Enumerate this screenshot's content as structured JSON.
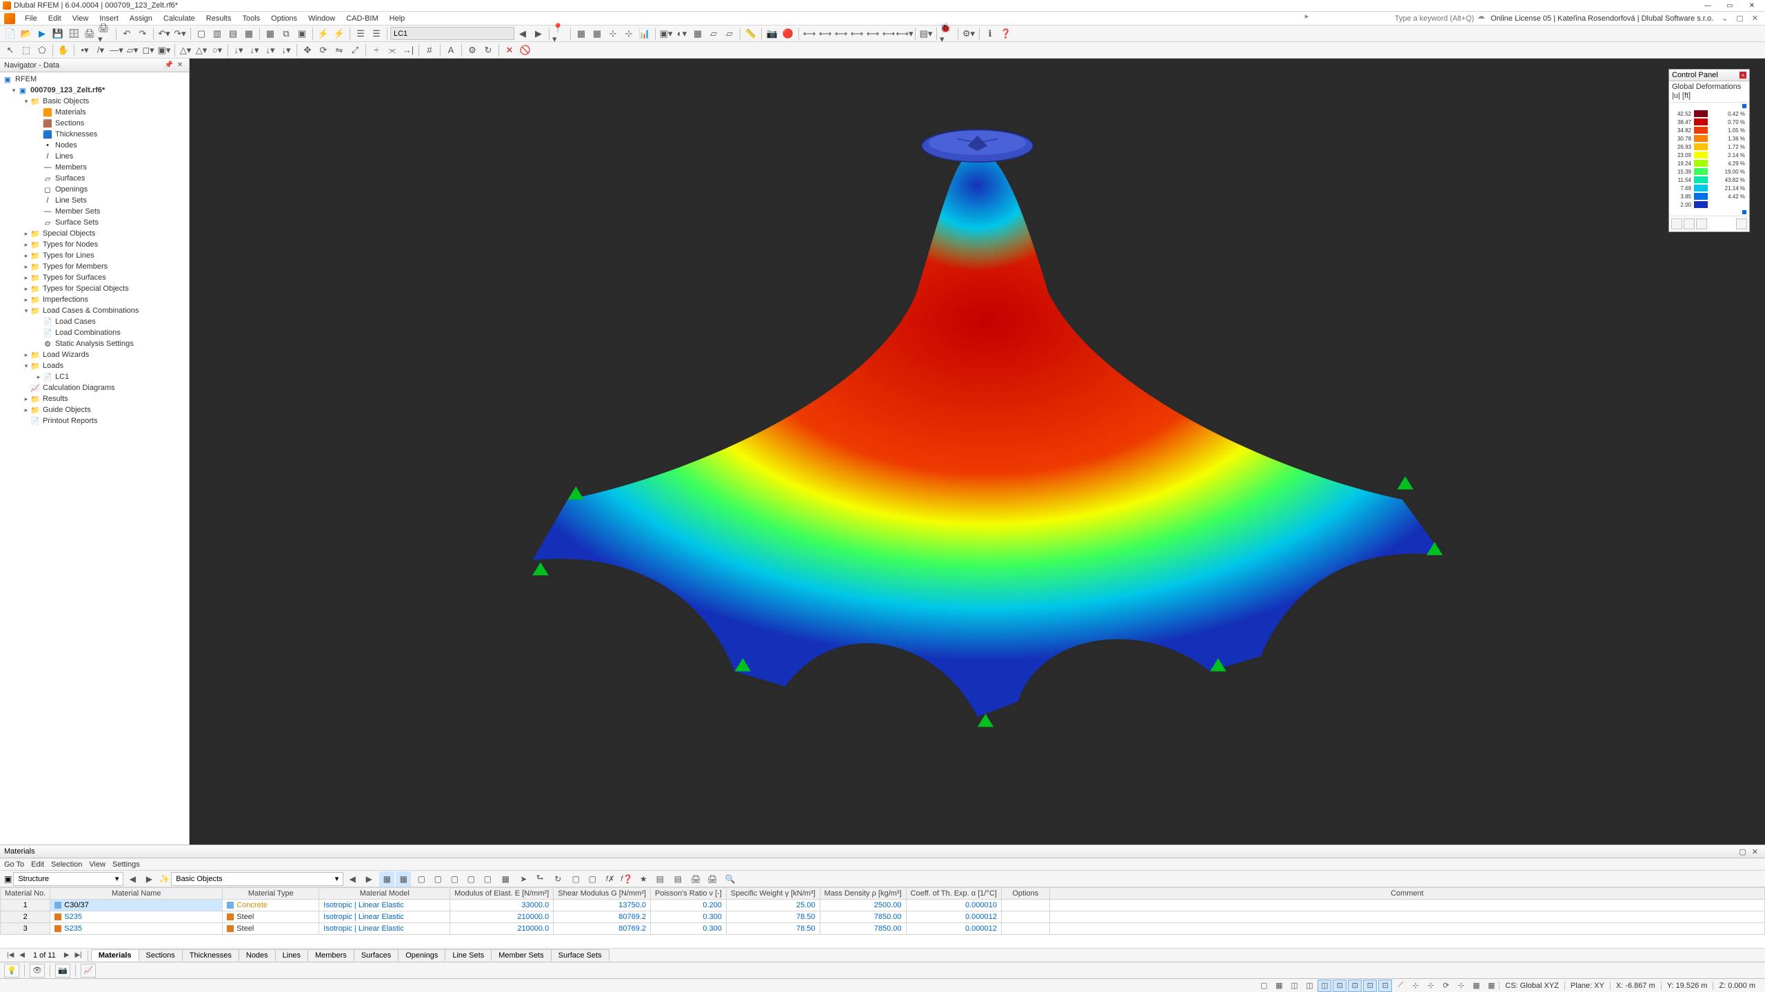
{
  "window": {
    "title": "Dlubal RFEM | 6.04.0004 | 000709_123_Zelt.rf6*",
    "search_placeholder": "Type a keyword (Alt+Q)",
    "license": "Online License 05 | Kateřina Rosendorfová | Dlubal Software s.r.o."
  },
  "menus": [
    "File",
    "Edit",
    "View",
    "Insert",
    "Assign",
    "Calculate",
    "Results",
    "Tools",
    "Options",
    "Window",
    "CAD-BIM",
    "Help"
  ],
  "toolbar": {
    "load_case": "LC1"
  },
  "navigator": {
    "title": "Navigator - Data",
    "root": "RFEM",
    "model": "000709_123_Zelt.rf6*",
    "items": [
      {
        "d": 1,
        "exp": true,
        "label": "Basic Objects",
        "folder": true
      },
      {
        "d": 2,
        "label": "Materials",
        "ic": "🟧"
      },
      {
        "d": 2,
        "label": "Sections",
        "ic": "🟫"
      },
      {
        "d": 2,
        "label": "Thicknesses",
        "ic": "🟦"
      },
      {
        "d": 2,
        "label": "Nodes",
        "ic": "•"
      },
      {
        "d": 2,
        "label": "Lines",
        "ic": "/"
      },
      {
        "d": 2,
        "label": "Members",
        "ic": "—"
      },
      {
        "d": 2,
        "label": "Surfaces",
        "ic": "▱"
      },
      {
        "d": 2,
        "label": "Openings",
        "ic": "◻"
      },
      {
        "d": 2,
        "label": "Line Sets",
        "ic": "/"
      },
      {
        "d": 2,
        "label": "Member Sets",
        "ic": "—"
      },
      {
        "d": 2,
        "label": "Surface Sets",
        "ic": "▱"
      },
      {
        "d": 1,
        "exp": false,
        "label": "Special Objects",
        "folder": true
      },
      {
        "d": 1,
        "exp": false,
        "label": "Types for Nodes",
        "folder": true
      },
      {
        "d": 1,
        "exp": false,
        "label": "Types for Lines",
        "folder": true
      },
      {
        "d": 1,
        "exp": false,
        "label": "Types for Members",
        "folder": true
      },
      {
        "d": 1,
        "exp": false,
        "label": "Types for Surfaces",
        "folder": true
      },
      {
        "d": 1,
        "exp": false,
        "label": "Types for Special Objects",
        "folder": true
      },
      {
        "d": 1,
        "exp": false,
        "label": "Imperfections",
        "folder": true
      },
      {
        "d": 1,
        "exp": true,
        "label": "Load Cases & Combinations",
        "folder": true
      },
      {
        "d": 2,
        "label": "Load Cases",
        "ic": "📄"
      },
      {
        "d": 2,
        "label": "Load Combinations",
        "ic": "📄"
      },
      {
        "d": 2,
        "label": "Static Analysis Settings",
        "ic": "⚙"
      },
      {
        "d": 1,
        "exp": false,
        "label": "Load Wizards",
        "folder": true
      },
      {
        "d": 1,
        "exp": true,
        "label": "Loads",
        "folder": true
      },
      {
        "d": 2,
        "label": "LC1",
        "ic": "📄",
        "exp": false
      },
      {
        "d": 1,
        "label": "Calculation Diagrams",
        "ic": "📈"
      },
      {
        "d": 1,
        "exp": false,
        "label": "Results",
        "folder": true
      },
      {
        "d": 1,
        "exp": false,
        "label": "Guide Objects",
        "folder": true
      },
      {
        "d": 1,
        "label": "Printout Reports",
        "ic": "📄"
      }
    ]
  },
  "control_panel": {
    "title": "Control Panel",
    "subtitle": "Global Deformations",
    "unit": "|u| [ft]",
    "legend": [
      {
        "val": "42.52",
        "color": "#7d0018",
        "pct": "0.42 %"
      },
      {
        "val": "38.47",
        "color": "#c40000",
        "pct": "0.70 %"
      },
      {
        "val": "34.82",
        "color": "#ee3b00",
        "pct": "1.05 %"
      },
      {
        "val": "30.78",
        "color": "#ff8200",
        "pct": "1.36 %"
      },
      {
        "val": "26.93",
        "color": "#ffc200",
        "pct": "1.72 %"
      },
      {
        "val": "23.09",
        "color": "#f5ff00",
        "pct": "2.14 %"
      },
      {
        "val": "19.24",
        "color": "#a6ff00",
        "pct": "4.29 %"
      },
      {
        "val": "15.39",
        "color": "#3dff5c",
        "pct": "19.00 %"
      },
      {
        "val": "11.54",
        "color": "#00e9a8",
        "pct": "43.82 %"
      },
      {
        "val": "7.69",
        "color": "#00c6e9",
        "pct": "21.14 %"
      },
      {
        "val": "3.85",
        "color": "#0070e9",
        "pct": "4.42 %"
      },
      {
        "val": "2.00",
        "color": "#1430b8",
        "pct": ""
      }
    ]
  },
  "materials": {
    "title": "Materials",
    "sub_menu": [
      "Go To",
      "Edit",
      "Selection",
      "View",
      "Settings"
    ],
    "structure_sel": "Structure",
    "basic_sel": "Basic Objects",
    "headers": {
      "no": "Material\nNo.",
      "name": "Material Name",
      "type": "Material\nType",
      "model": "Material Model",
      "E": "Modulus of Elast.\nE [N/mm²]",
      "G": "Shear Modulus\nG [N/mm²]",
      "v": "Poisson's Ratio\nν [-]",
      "gamma": "Specific Weight\nγ [kN/m³]",
      "rho": "Mass Density\nρ [kg/m³]",
      "alpha": "Coeff. of Th. Exp.\nα [1/°C]",
      "opts": "Options",
      "comment": "Comment"
    },
    "rows": [
      {
        "no": "1",
        "name": "C30/37",
        "sw": "#6db1e6",
        "type": "Concrete",
        "tc": "#d98a00",
        "model": "Isotropic | Linear Elastic",
        "E": "33000.0",
        "G": "13750.0",
        "v": "0.200",
        "gamma": "25.00",
        "rho": "2500.00",
        "alpha": "0.000010",
        "sel": true
      },
      {
        "no": "2",
        "name": "S235",
        "sw": "#e07a1a",
        "type": "Steel",
        "tc": "#333",
        "model": "Isotropic | Linear Elastic",
        "E": "210000.0",
        "G": "80769.2",
        "v": "0.300",
        "gamma": "78.50",
        "rho": "7850.00",
        "alpha": "0.000012"
      },
      {
        "no": "3",
        "name": "S235",
        "sw": "#e07a1a",
        "type": "Steel",
        "tc": "#333",
        "model": "Isotropic | Linear Elastic",
        "E": "210000.0",
        "G": "80769.2",
        "v": "0.300",
        "gamma": "78.50",
        "rho": "7850.00",
        "alpha": "0.000012"
      }
    ],
    "page_info": "1 of 11",
    "tabs": [
      "Materials",
      "Sections",
      "Thicknesses",
      "Nodes",
      "Lines",
      "Members",
      "Surfaces",
      "Openings",
      "Line Sets",
      "Member Sets",
      "Surface Sets"
    ]
  },
  "status": {
    "cs": "CS: Global XYZ",
    "plane": "Plane: XY",
    "x": "X: -6.867 m",
    "y": "Y: 19.526 m",
    "z": "Z: 0.000 m"
  }
}
